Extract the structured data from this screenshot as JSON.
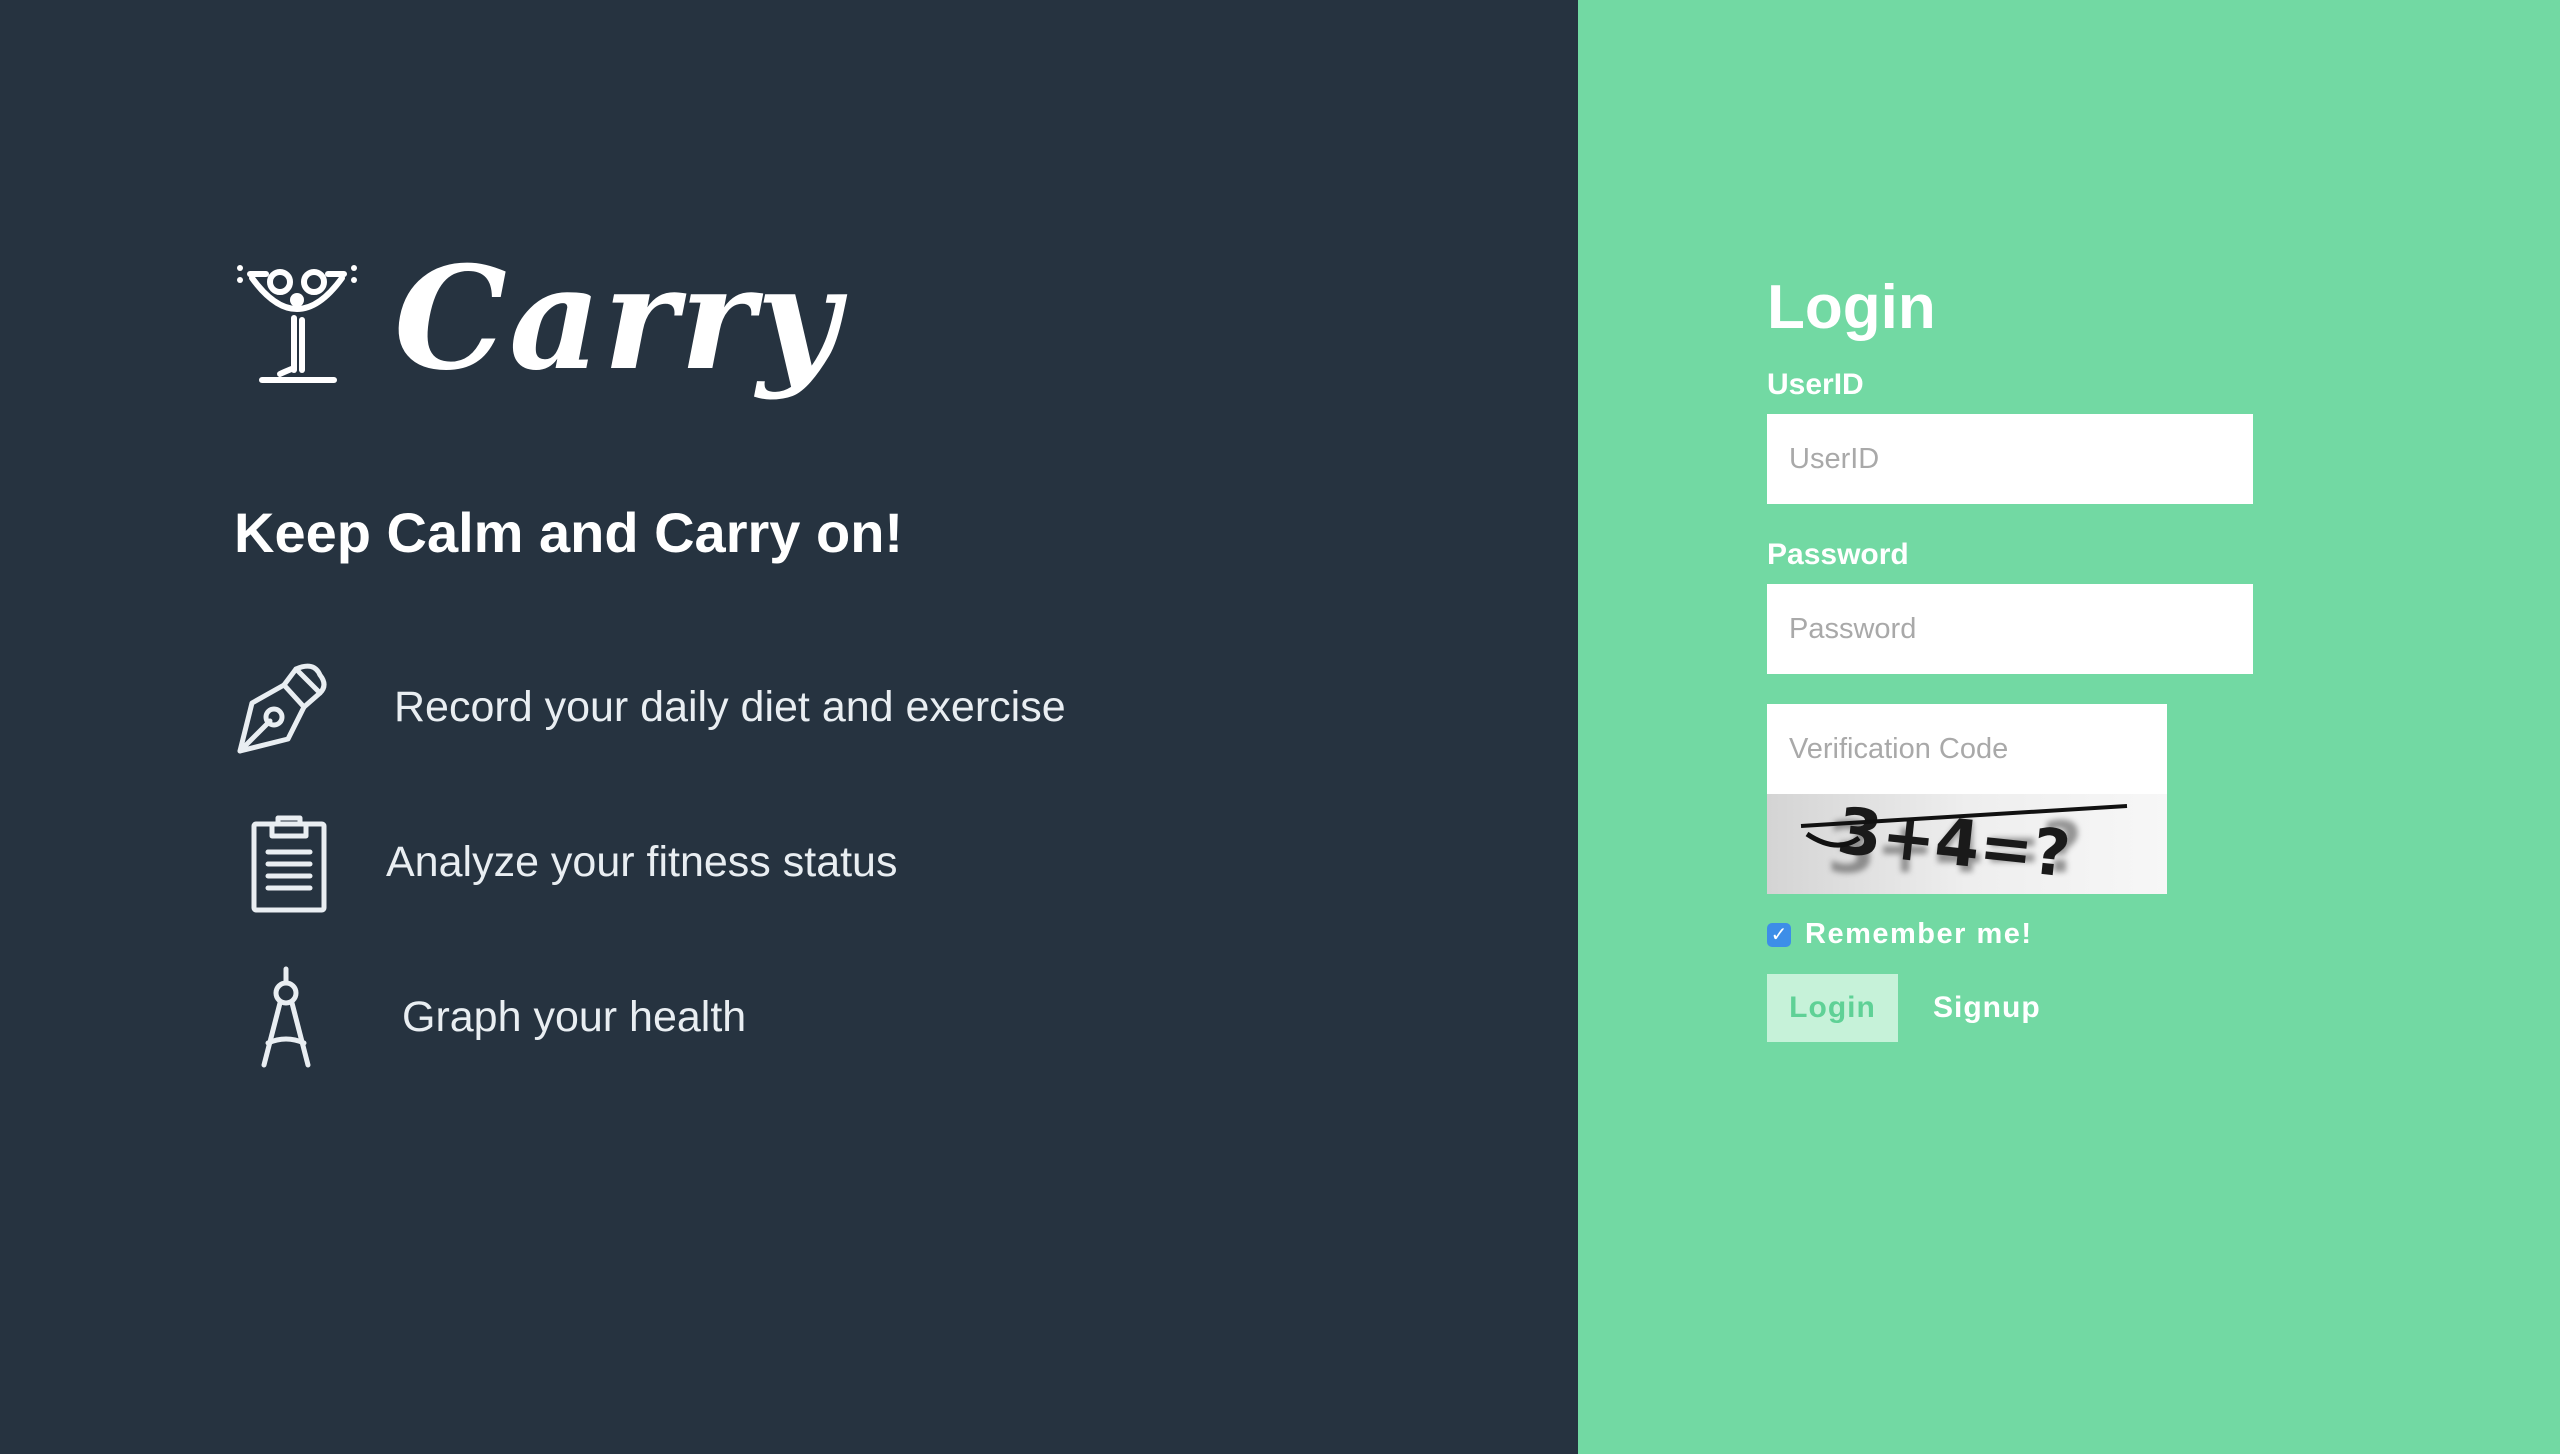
{
  "brand": {
    "name": "Carry",
    "tagline": "Keep Calm and Carry on!"
  },
  "features": [
    {
      "icon": "pen-nib-icon",
      "text": "Record your daily diet and exercise"
    },
    {
      "icon": "clipboard-icon",
      "text": "Analyze your fitness status"
    },
    {
      "icon": "compass-icon",
      "text": "Graph your health"
    }
  ],
  "login": {
    "title": "Login",
    "userid_label": "UserID",
    "userid_placeholder": "UserID",
    "password_label": "Password",
    "password_placeholder": "Password",
    "code_placeholder": "Verification Code",
    "captcha_text": "3+4=?",
    "remember_label": "Remember me!",
    "remember_checked": true,
    "login_button": "Login",
    "signup_link": "Signup"
  },
  "colors": {
    "left_bg": "#263340",
    "right_bg": "#72d9a3",
    "login_button_bg": "#c6f2d9",
    "login_button_text": "#5fd196",
    "checkbox": "#3d8ee8"
  }
}
